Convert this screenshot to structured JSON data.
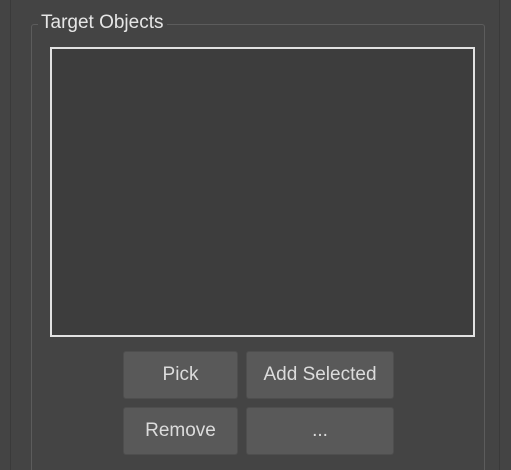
{
  "group": {
    "title": "Target Objects"
  },
  "buttons": {
    "pick": "Pick",
    "add_selected": "Add Selected",
    "remove": "Remove",
    "more": "..."
  },
  "colors": {
    "panel_background": "#444444",
    "list_background": "#3d3d3d",
    "list_border": "#e2e2e2",
    "button_background": "#595959",
    "text": "#dcdcdc"
  }
}
